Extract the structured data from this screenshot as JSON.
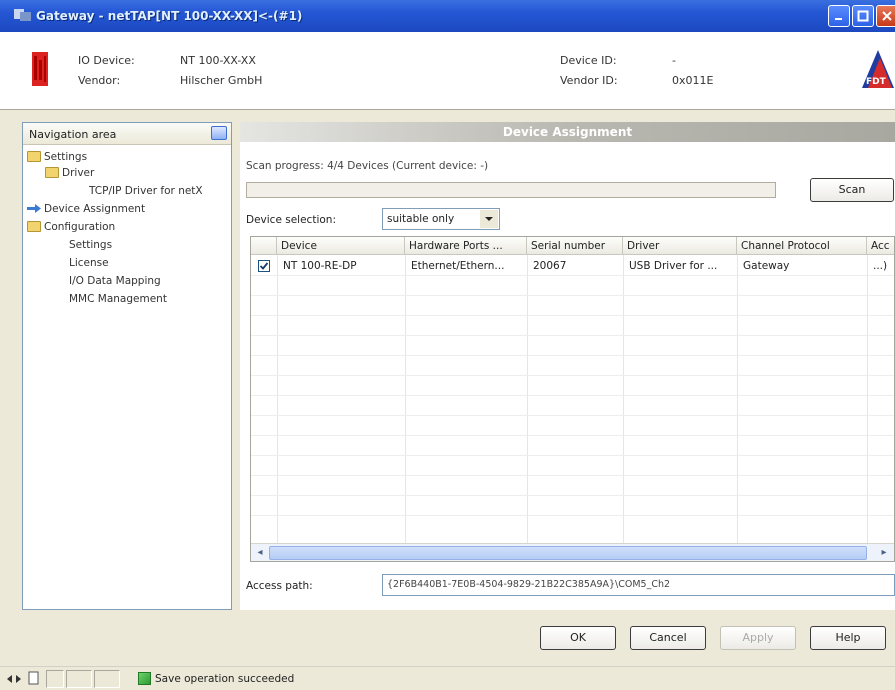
{
  "window": {
    "title": "Gateway - netTAP[NT 100-XX-XX]<-(#1)"
  },
  "device_header": {
    "io_device_label": "IO Device:",
    "io_device_value": "NT 100-XX-XX",
    "vendor_label": "Vendor:",
    "vendor_value": "Hilscher GmbH",
    "device_id_label": "Device ID:",
    "device_id_value": "-",
    "vendor_id_label": "Vendor ID:",
    "vendor_id_value": "0x011E",
    "fdt_logo_text": "FDT"
  },
  "navigation": {
    "title": "Navigation area",
    "items": [
      {
        "label": "Settings"
      },
      {
        "label": "Driver"
      },
      {
        "label": "TCP/IP Driver for netX"
      },
      {
        "label": "Device Assignment"
      },
      {
        "label": "Configuration"
      },
      {
        "label": "Settings"
      },
      {
        "label": "License"
      },
      {
        "label": "I/O Data Mapping"
      },
      {
        "label": "MMC Management"
      }
    ]
  },
  "main": {
    "title": "Device Assignment",
    "scan_progress": "Scan progress: 4/4 Devices (Current device: -)",
    "scan_button": "Scan",
    "device_selection_label": "Device selection:",
    "device_selection_value": "suitable only",
    "table": {
      "columns": [
        "Device",
        "Hardware Ports ...",
        "Serial number",
        "Driver",
        "Channel Protocol",
        "Acc"
      ],
      "rows": [
        {
          "checked": true,
          "cells": [
            "NT 100-RE-DP",
            "Ethernet/Ethern...",
            "20067",
            "USB Driver for ...",
            "Gateway",
            "...)"
          ]
        }
      ]
    },
    "access_path_label": "Access path:",
    "access_path_value": "{2F6B440B1-7E0B-4504-9829-21B22C385A9A}\\COM5_Ch2"
  },
  "buttons": {
    "ok": "OK",
    "cancel": "Cancel",
    "apply": "Apply",
    "help": "Help"
  },
  "status": {
    "message": "Save operation succeeded"
  },
  "colors": {
    "titlebar": "#2456d4",
    "panel_header": "#b9b8b1",
    "background": "#ece9d8"
  }
}
